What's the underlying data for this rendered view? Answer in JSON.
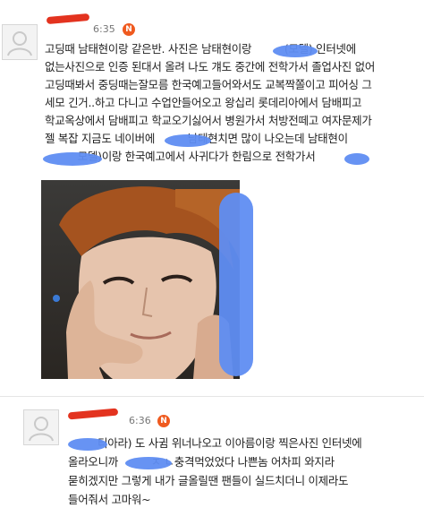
{
  "comments": [
    {
      "time": "6:35",
      "badge": "N",
      "lines": [
        "고딩때 남태현이랑 같은반. 사진은 남태현이랑          (모델) 인터넷에",
        "없는사진으로 인증 된대서 올려 나도 걔도 중간에 전학가서 졸업사진 없어",
        "고딩때봐서 중딩때는잘모름 한국예고들어와서도 교복짝쫄이고 피어싱 그",
        "세모 긴거..하고 다니고 수업안들어오고 왕십리 롯데리아에서 담배피고",
        "학교옥상에서 담배피고 학교오기싫어서 병원가서 처방전떼고 여자문제가",
        "젤 복잡 지금도 네이버에          남태현치면 많이 나오는데 남태현이",
        "          모델)이랑 한국예고에서 사귀다가 한림으로 전학가서"
      ]
    },
    {
      "time": "6:36",
      "badge": "N",
      "lines": [
        "         티아라) 도 사귐 위너나오고 이아름이랑 찍은사진 인터넷에",
        "올라오니까          ㅈ ㄴ충격먹었었다 나쁜놈 어차피 와지라",
        "묻히겠지만 그렇게 내가 글올릴땐 팬들이 실드치더니 이제라도",
        "들어줘서 고마워~"
      ]
    }
  ],
  "photo": {
    "description_icon": "portrait-photo"
  },
  "colors": {
    "badge": "#ef5a1f",
    "redact_blue": "#5f8df2",
    "redact_red": "#e3331f"
  }
}
